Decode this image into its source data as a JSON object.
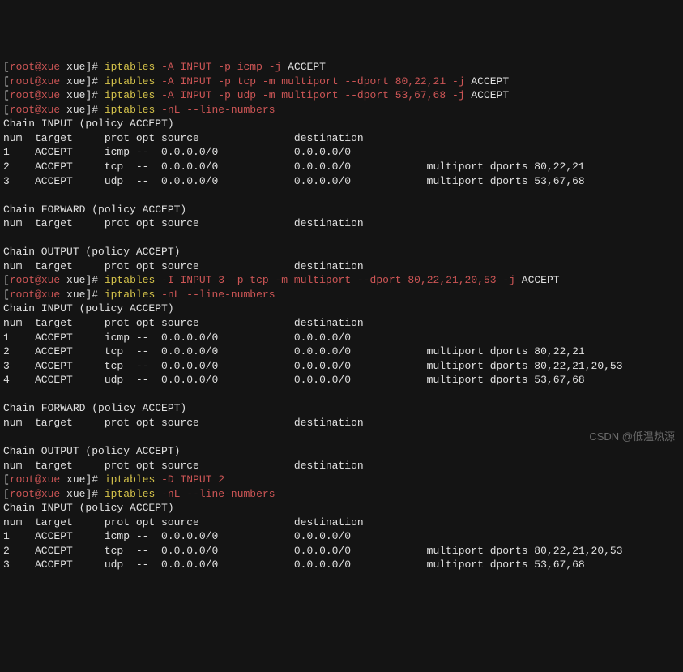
{
  "prompt_user": "root@xue",
  "prompt_host": "xue",
  "cmd1": {
    "prog": "iptables",
    "args1": " -A INPUT -p icmp -j",
    "args2": " ACCEPT"
  },
  "cmd2": {
    "prog": "iptables",
    "args1": " -A INPUT -p tcp -m multiport --dport 80,22,21 -j",
    "args2": " ACCEPT"
  },
  "cmd3": {
    "prog": "iptables",
    "args1": " -A INPUT -p udp -m multiport --dport 53,67,68 -j",
    "args2": " ACCEPT"
  },
  "cmd4": {
    "prog": "iptables",
    "args1": " -nL --line-numbers"
  },
  "chain_input": "Chain INPUT (policy ACCEPT)",
  "chain_forward": "Chain FORWARD (policy ACCEPT)",
  "chain_output": "Chain OUTPUT (policy ACCEPT)",
  "header": "num  target     prot opt source               destination",
  "block1": {
    "r1": "1    ACCEPT     icmp --  0.0.0.0/0            0.0.0.0/0",
    "r2": "2    ACCEPT     tcp  --  0.0.0.0/0            0.0.0.0/0            multiport dports 80,22,21",
    "r3": "3    ACCEPT     udp  --  0.0.0.0/0            0.0.0.0/0            multiport dports 53,67,68"
  },
  "cmd5": {
    "prog": "iptables",
    "args1": " -I INPUT 3 -p tcp -m multiport --dport 80,22,21,20,53 -j",
    "args2": " ACCEPT"
  },
  "cmd6": {
    "prog": "iptables",
    "args1": " -nL --line-numbers"
  },
  "block2": {
    "r1": "1    ACCEPT     icmp --  0.0.0.0/0            0.0.0.0/0",
    "r2": "2    ACCEPT     tcp  --  0.0.0.0/0            0.0.0.0/0            multiport dports 80,22,21",
    "r3": "3    ACCEPT     tcp  --  0.0.0.0/0            0.0.0.0/0            multiport dports 80,22,21,20,53",
    "r4": "4    ACCEPT     udp  --  0.0.0.0/0            0.0.0.0/0            multiport dports 53,67,68"
  },
  "cmd7": {
    "prog": "iptables",
    "args1": " -D INPUT 2"
  },
  "cmd8": {
    "prog": "iptables",
    "args1": " -nL --line-numbers"
  },
  "block3": {
    "r1": "1    ACCEPT     icmp --  0.0.0.0/0            0.0.0.0/0",
    "r2": "2    ACCEPT     tcp  --  0.0.0.0/0            0.0.0.0/0            multiport dports 80,22,21,20,53",
    "r3": "3    ACCEPT     udp  --  0.0.0.0/0            0.0.0.0/0            multiport dports 53,67,68"
  },
  "watermark": "CSDN @低温热源"
}
